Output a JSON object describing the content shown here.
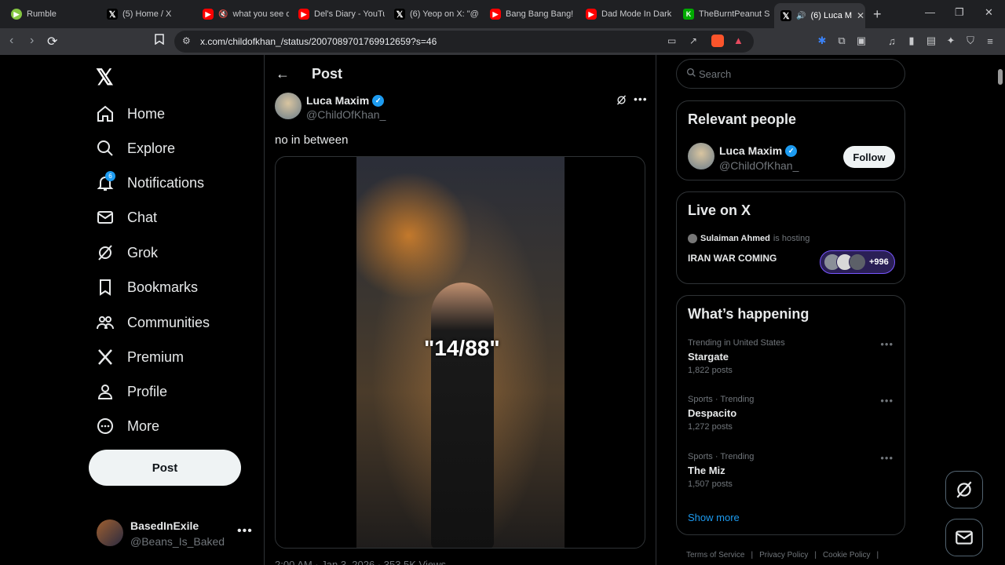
{
  "browser": {
    "tabs": [
      {
        "title": "Rumble",
        "icon": "rumble-favicon"
      },
      {
        "title": "(5) Home / X",
        "icon": "x-favicon"
      },
      {
        "title": "what you see o",
        "icon": "youtube-favicon"
      },
      {
        "title": "Del's Diary - YouTu",
        "icon": "youtube-favicon"
      },
      {
        "title": "(6) Yeop on X: \"@",
        "icon": "x-favicon"
      },
      {
        "title": "Bang Bang Bang!",
        "icon": "youtube-favicon"
      },
      {
        "title": "Dad Mode In Dark",
        "icon": "youtube-favicon"
      },
      {
        "title": "TheBurntPeanut Sl",
        "icon": "burntpeanut-favicon"
      },
      {
        "title": "(6) Luca M",
        "icon": "x-favicon"
      }
    ],
    "url": "x.com/childofkhan_/status/2007089701769912659?s=46"
  },
  "nav": {
    "items": [
      {
        "label": "Home",
        "icon": "home-icon"
      },
      {
        "label": "Explore",
        "icon": "search-icon"
      },
      {
        "label": "Notifications",
        "icon": "bell-icon"
      },
      {
        "label": "Chat",
        "icon": "mail-icon"
      },
      {
        "label": "Grok",
        "icon": "grok-icon"
      },
      {
        "label": "Bookmarks",
        "icon": "bookmark-icon"
      },
      {
        "label": "Communities",
        "icon": "communities-icon"
      },
      {
        "label": "Premium",
        "icon": "x-icon"
      },
      {
        "label": "Profile",
        "icon": "person-icon"
      },
      {
        "label": "More",
        "icon": "more-circle-icon"
      }
    ],
    "notification_count": "6",
    "post_button": "Post",
    "account": {
      "name": "BasedInExile",
      "handle": "@Beans_Is_Baked"
    }
  },
  "post": {
    "header": "Post",
    "author_name": "Luca Maxim",
    "author_handle": "@ChildOfKhan_",
    "text": "no in between",
    "media_caption": "\"14/88\"",
    "meta": "2:00 AM · Jan 3, 2026 · 353.5K Views"
  },
  "sidebar": {
    "search_placeholder": "Search",
    "relevant": {
      "title": "Relevant people",
      "name": "Luca Maxim",
      "handle": "@ChildOfKhan_",
      "follow": "Follow"
    },
    "live": {
      "title": "Live on X",
      "host": "Sulaiman Ahmed",
      "host_suffix": "is hosting",
      "space_title": "IRAN WAR COMING",
      "listener_count": "+996"
    },
    "happening": {
      "title": "What’s happening",
      "trends": [
        {
          "meta": "Trending in United States",
          "name": "Stargate",
          "count": "1,822 posts"
        },
        {
          "meta": "Sports · Trending",
          "name": "Despacito",
          "count": "1,272 posts"
        },
        {
          "meta": "Sports · Trending",
          "name": "The Miz",
          "count": "1,507 posts"
        }
      ],
      "show_more": "Show more"
    },
    "footer": [
      "Terms of Service",
      "|",
      "Privacy Policy",
      "|",
      "Cookie Policy",
      "|"
    ]
  },
  "colors": {
    "accent": "#1d9bf0",
    "background": "#000000",
    "border": "#2f3336",
    "muted": "#71767b"
  }
}
